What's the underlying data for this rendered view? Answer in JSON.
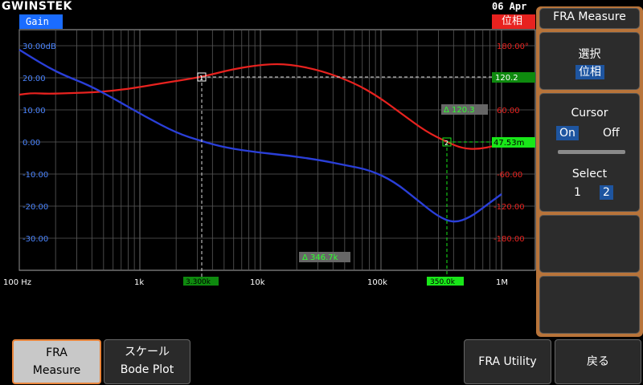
{
  "header": {
    "brand": "GWINSTEK",
    "date": "06 Apr"
  },
  "plot": {
    "gain_label": "Gain",
    "phase_label": "位相",
    "left_ticks": [
      "30.00dB",
      "20.00",
      "10.00",
      "0.00",
      "-10.00",
      "-20.00",
      "-30.00"
    ],
    "right_ticks": [
      "180.00°",
      "120.00",
      "60.00",
      "",
      "-60.00",
      "-120.00",
      "-180.00"
    ],
    "x_ticks": [
      "100 Hz",
      "1k",
      "10k",
      "100k",
      "1M"
    ],
    "cursor1": {
      "marker": "1",
      "freq": "3.300k",
      "readout": "120.2"
    },
    "cursor2": {
      "marker": "2",
      "freq": "350.0k",
      "readout": "47.53m"
    },
    "delta_y": "Δ 120.3",
    "delta_x": "Δ 346.7k",
    "colors": {
      "gain": "#2a3fd8",
      "phase": "#e8221f",
      "cursor1": "#0e8a0e",
      "cursor2": "#19e619"
    }
  },
  "panel": {
    "title": "FRA Measure",
    "select_label": "選択",
    "select_value": "位相",
    "cursor_label": "Cursor",
    "cursor_on": "On",
    "cursor_off": "Off",
    "cursor_state": "On",
    "select_num_label": "Select",
    "select_opt1": "1",
    "select_opt2": "2",
    "selected_cursor": "2"
  },
  "softkeys": {
    "fra_measure": [
      "FRA",
      "Measure"
    ],
    "scale": [
      "スケール",
      "Bode Plot"
    ],
    "fra_utility": "FRA Utility",
    "back": "戻る"
  }
}
